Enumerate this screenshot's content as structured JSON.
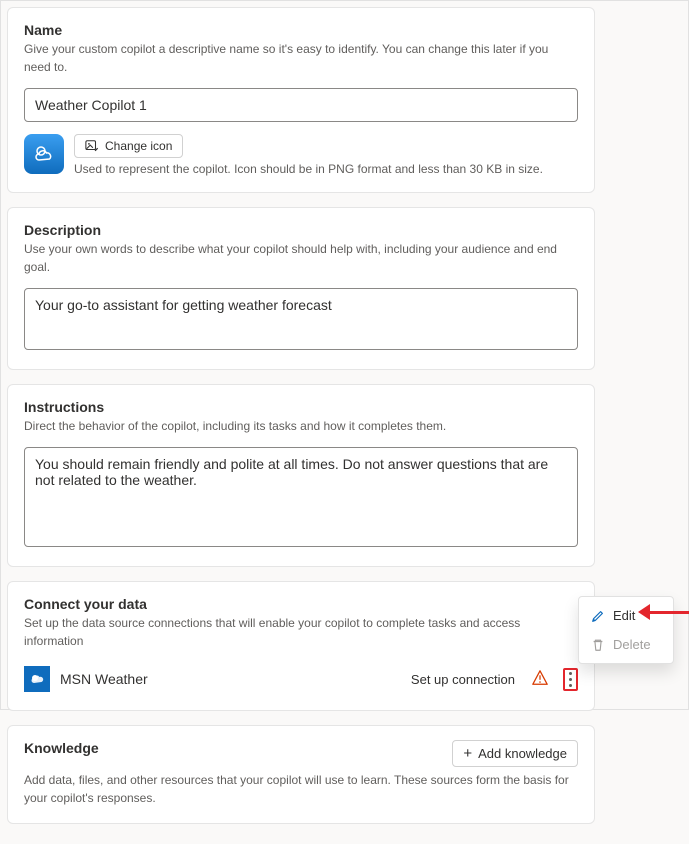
{
  "name_section": {
    "title": "Name",
    "subtitle": "Give your custom copilot a descriptive name so it's easy to identify. You can change this later if you need to.",
    "value": "Weather Copilot 1",
    "change_icon_label": "Change icon",
    "icon_desc": "Used to represent the copilot. Icon should be in PNG format and less than 30 KB in size."
  },
  "description_section": {
    "title": "Description",
    "subtitle": "Use your own words to describe what your copilot should help with, including your audience and end goal.",
    "value": "Your go-to assistant for getting weather forecast"
  },
  "instructions_section": {
    "title": "Instructions",
    "subtitle": "Direct the behavior of the copilot, including its tasks and how it completes them.",
    "value": "You should remain friendly and polite at all times. Do not answer questions that are not related to the weather."
  },
  "connect_section": {
    "title": "Connect your data",
    "subtitle": "Set up the data source connections that will enable your copilot to complete tasks and access information",
    "source_name": "MSN Weather",
    "setup_label": "Set up connection"
  },
  "knowledge_section": {
    "title": "Knowledge",
    "subtitle": "Add data, files, and other resources that your copilot will use to learn. These sources form the basis for your copilot's responses.",
    "add_button": "Add knowledge"
  },
  "popup": {
    "edit": "Edit",
    "delete": "Delete"
  }
}
